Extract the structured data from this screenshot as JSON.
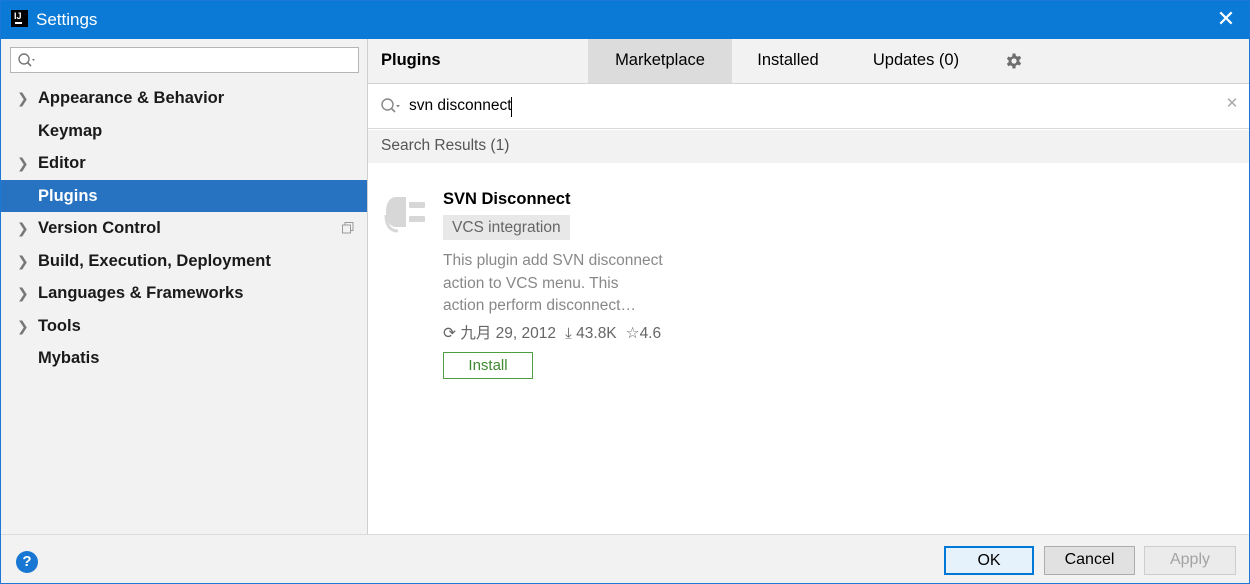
{
  "window": {
    "title": "Settings",
    "app_icon_text": "IJ"
  },
  "sidebar": {
    "search": {
      "value": "",
      "placeholder": ""
    },
    "items": [
      {
        "label": "Appearance & Behavior",
        "expandable": true
      },
      {
        "label": "Keymap",
        "expandable": false
      },
      {
        "label": "Editor",
        "expandable": true
      },
      {
        "label": "Plugins",
        "expandable": false,
        "selected": true
      },
      {
        "label": "Version Control",
        "expandable": true
      },
      {
        "label": "Build, Execution, Deployment",
        "expandable": true
      },
      {
        "label": "Languages & Frameworks",
        "expandable": true
      },
      {
        "label": "Tools",
        "expandable": true
      },
      {
        "label": "Mybatis",
        "expandable": false
      }
    ]
  },
  "plugins_panel": {
    "title": "Plugins",
    "tabs": [
      {
        "label": "Marketplace",
        "active": true
      },
      {
        "label": "Installed",
        "active": false
      },
      {
        "label": "Updates (0)",
        "active": false
      }
    ],
    "search": {
      "value": "svn disconnect"
    },
    "results_header": "Search Results (1)",
    "results": [
      {
        "name": "SVN Disconnect",
        "tag": "VCS integration",
        "description_lines": [
          "This plugin add SVN disconnect",
          "action to VCS menu. This",
          "action perform disconnect…"
        ],
        "date": "九月 29, 2012",
        "downloads": "43.8K",
        "rating": "4.6",
        "install_label": "Install"
      }
    ]
  },
  "footer": {
    "help": "?",
    "ok_label": "OK",
    "cancel_label": "Cancel",
    "apply_label": "Apply"
  },
  "colors": {
    "titlebar": "#0b7ad7",
    "selection": "#2773c2",
    "install_green": "#4d9d3f"
  }
}
